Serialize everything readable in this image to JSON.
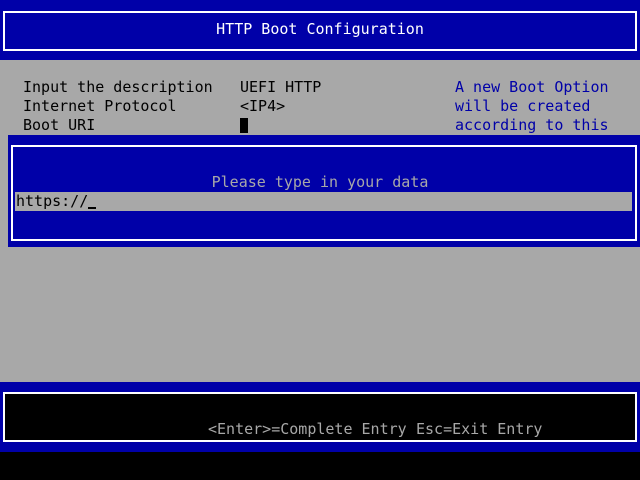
{
  "window": {
    "title": "HTTP Boot Configuration"
  },
  "form": {
    "rows": [
      {
        "label": "Input the description",
        "value": "UEFI HTTP"
      },
      {
        "label": "Internet Protocol",
        "value": "<IP4>"
      },
      {
        "label": "Boot URI",
        "value": ""
      }
    ]
  },
  "help_text": {
    "lines": [
      "A new Boot Option",
      "will be created",
      "according to this"
    ]
  },
  "popup": {
    "prompt": "Please type in your data",
    "input_value": "https://"
  },
  "footer": {
    "enter_hint": "<Enter>=Complete Entry",
    "esc_hint": "Esc=Exit Entry"
  },
  "colors": {
    "background": "#a8a8a8",
    "title_bar": "#0000a8",
    "popup": "#0000a8",
    "help_text": "#0000a8",
    "footer": "#000000"
  }
}
